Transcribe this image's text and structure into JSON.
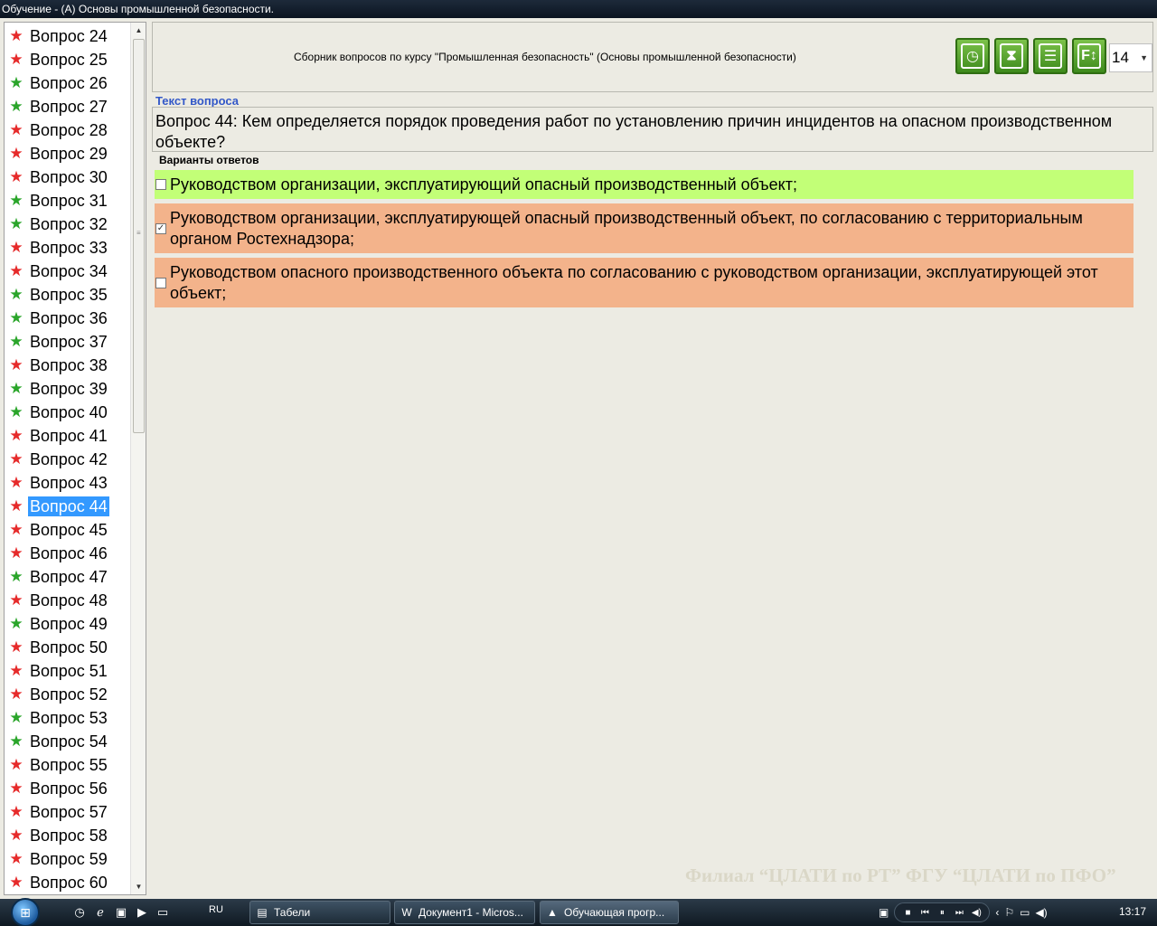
{
  "window": {
    "title": "Обучение - (А) Основы промышленной безопасности."
  },
  "question_list": {
    "items": [
      {
        "label": "Вопрос 24",
        "status": "red"
      },
      {
        "label": "Вопрос 25",
        "status": "red"
      },
      {
        "label": "Вопрос 26",
        "status": "green"
      },
      {
        "label": "Вопрос 27",
        "status": "green"
      },
      {
        "label": "Вопрос 28",
        "status": "red"
      },
      {
        "label": "Вопрос 29",
        "status": "red"
      },
      {
        "label": "Вопрос 30",
        "status": "red"
      },
      {
        "label": "Вопрос 31",
        "status": "green"
      },
      {
        "label": "Вопрос 32",
        "status": "green"
      },
      {
        "label": "Вопрос 33",
        "status": "red"
      },
      {
        "label": "Вопрос 34",
        "status": "red"
      },
      {
        "label": "Вопрос 35",
        "status": "green"
      },
      {
        "label": "Вопрос 36",
        "status": "green"
      },
      {
        "label": "Вопрос 37",
        "status": "green"
      },
      {
        "label": "Вопрос 38",
        "status": "red"
      },
      {
        "label": "Вопрос 39",
        "status": "green"
      },
      {
        "label": "Вопрос 40",
        "status": "green"
      },
      {
        "label": "Вопрос 41",
        "status": "red"
      },
      {
        "label": "Вопрос 42",
        "status": "red"
      },
      {
        "label": "Вопрос 43",
        "status": "red"
      },
      {
        "label": "Вопрос 44",
        "status": "red",
        "selected": true
      },
      {
        "label": "Вопрос 45",
        "status": "red"
      },
      {
        "label": "Вопрос 46",
        "status": "red"
      },
      {
        "label": "Вопрос 47",
        "status": "green"
      },
      {
        "label": "Вопрос 48",
        "status": "red"
      },
      {
        "label": "Вопрос 49",
        "status": "green"
      },
      {
        "label": "Вопрос 50",
        "status": "red"
      },
      {
        "label": "Вопрос 51",
        "status": "red"
      },
      {
        "label": "Вопрос 52",
        "status": "red"
      },
      {
        "label": "Вопрос 53",
        "status": "green"
      },
      {
        "label": "Вопрос 54",
        "status": "green"
      },
      {
        "label": "Вопрос 55",
        "status": "red"
      },
      {
        "label": "Вопрос 56",
        "status": "red"
      },
      {
        "label": "Вопрос 57",
        "status": "red"
      },
      {
        "label": "Вопрос 58",
        "status": "red"
      },
      {
        "label": "Вопрос 59",
        "status": "red"
      },
      {
        "label": "Вопрос 60",
        "status": "red"
      }
    ]
  },
  "header": {
    "title": "Сборник вопросов по курсу \"Промышленная безопасность\" (Основы промышленной безопасности)",
    "tools": [
      "clock-icon",
      "hourglass-icon",
      "list-icon",
      "font-size-icon"
    ],
    "font_size": "14"
  },
  "question": {
    "section_label": "Текст вопроса",
    "text": "Вопрос 44: Кем определяется порядок проведения работ по установлению причин инцидентов на опасном производственном объекте?"
  },
  "answers": {
    "section_label": "Варианты ответов",
    "items": [
      {
        "text": "Руководством организации, эксплуатирующий опасный производственный объект;",
        "checked": false
      },
      {
        "text": "Руководством организации, эксплуатирующей опасный производственный объект, по согласованию с территориальным органом Ростехнадзора;",
        "checked": true
      },
      {
        "text": "Руководством опасного производственного объекта по согласованию с руководством организации, эксплуатирующей этот объект;",
        "checked": false
      }
    ]
  },
  "footer": {
    "brand": "Филиал “ЦЛАТИ по РТ” ФГУ “ЦЛАТИ по ПФО”"
  },
  "taskbar": {
    "lang": "RU",
    "tasks": [
      "Табели",
      "Документ1 - Micros...",
      "Обучающая прогр..."
    ],
    "clock": "13:17"
  },
  "colors": {
    "correct": "#c2ff77",
    "wrong": "#f3b38b",
    "selected": "#3399ff",
    "star_red": "#e62a2a",
    "star_green": "#2aa52a"
  }
}
